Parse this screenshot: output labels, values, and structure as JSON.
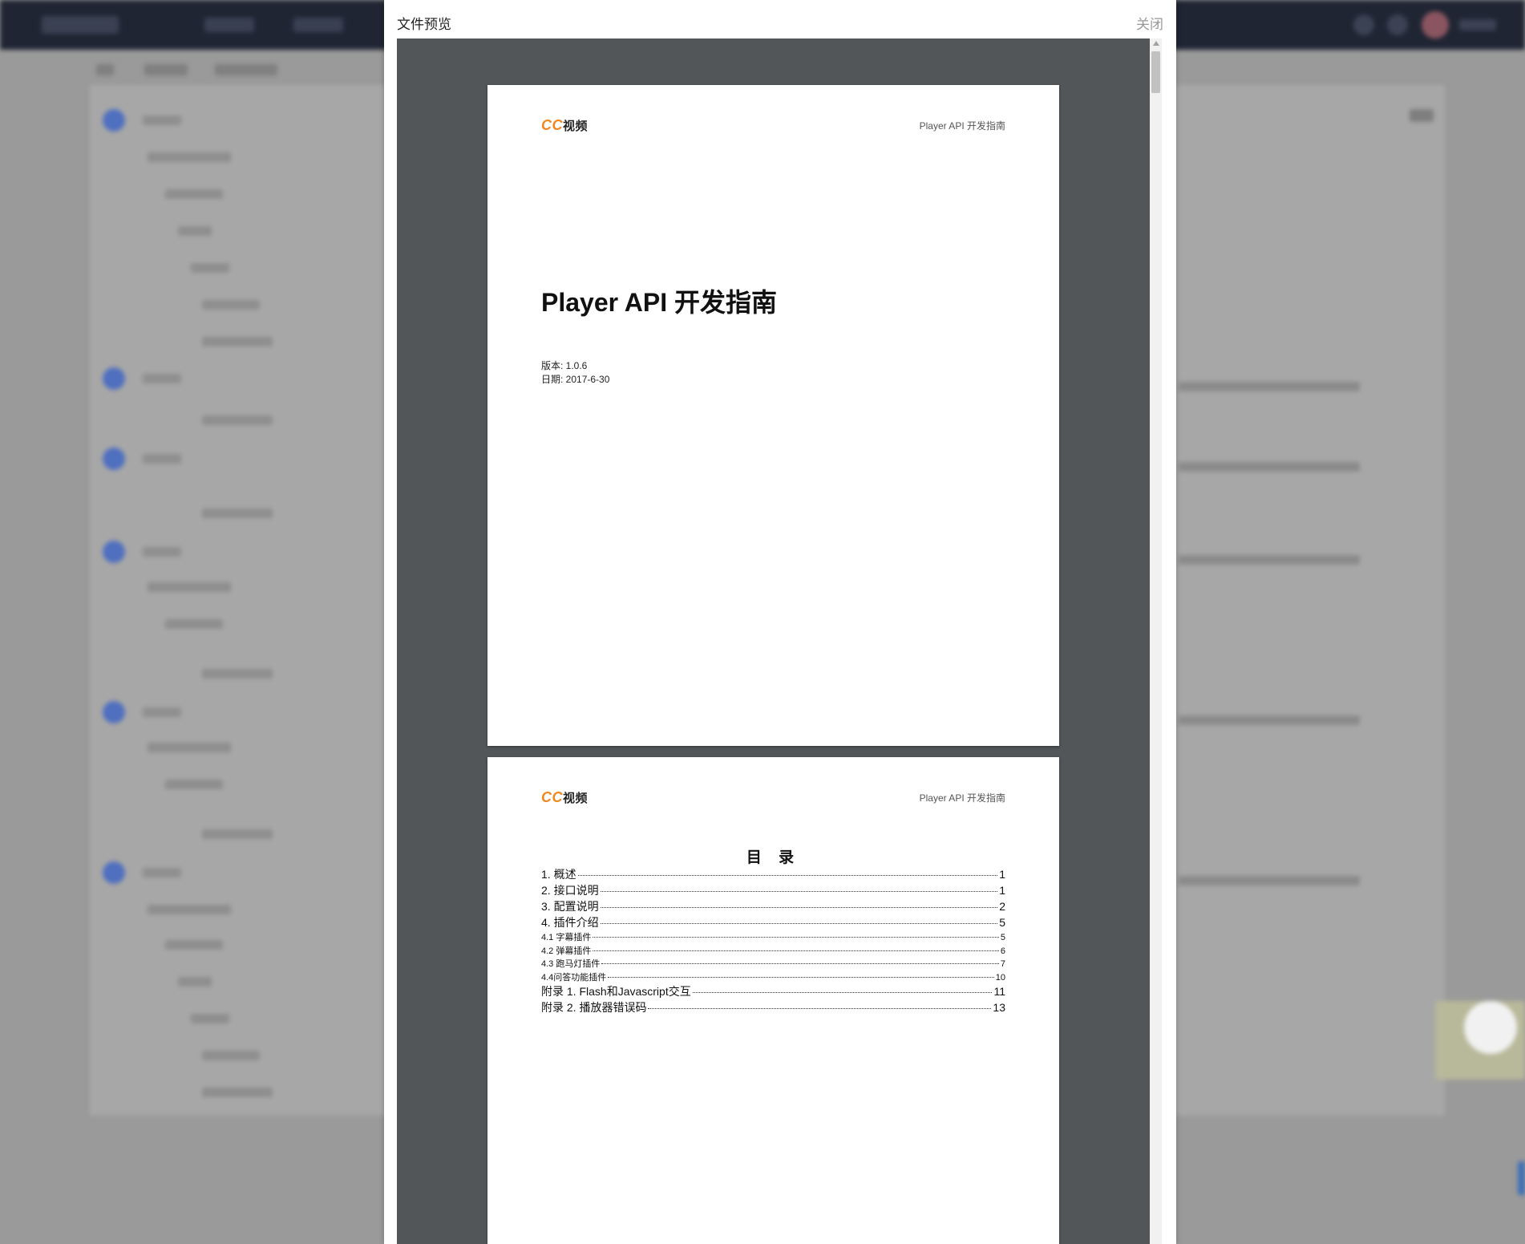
{
  "modal": {
    "title": "文件预览",
    "close_label": "关闭"
  },
  "document": {
    "brand_cc": "CC",
    "brand_text": "视频",
    "header_text": "Player API 开发指南",
    "title": "Player API 开发指南",
    "version_line": "版本: 1.0.6",
    "date_line": "日期: 2017-6-30"
  },
  "toc": {
    "heading": "目 录",
    "items": [
      {
        "text": "1. 概述",
        "page": "1",
        "level": 1
      },
      {
        "text": "2. 接口说明",
        "page": "1",
        "level": 1
      },
      {
        "text": "3. 配置说明",
        "page": "2",
        "level": 1
      },
      {
        "text": "4. 插件介绍",
        "page": "5",
        "level": 1
      },
      {
        "text": "4.1 字幕插件",
        "page": "5",
        "level": 2
      },
      {
        "text": "4.2 弹幕插件",
        "page": "6",
        "level": 2
      },
      {
        "text": "4.3 跑马灯插件",
        "page": "7",
        "level": 2
      },
      {
        "text": "4.4问答功能插件",
        "page": "10",
        "level": 2
      },
      {
        "text": "附录 1. Flash和Javascript交互",
        "page": "11",
        "level": 1
      },
      {
        "text": "附录 2. 播放器错误码",
        "page": "13",
        "level": 1
      }
    ]
  },
  "colors": {
    "brand_orange": "#f0871e",
    "viewer_bg": "#525659",
    "topbar_bg": "#1f2533",
    "step_blue": "#4f6fbf"
  }
}
